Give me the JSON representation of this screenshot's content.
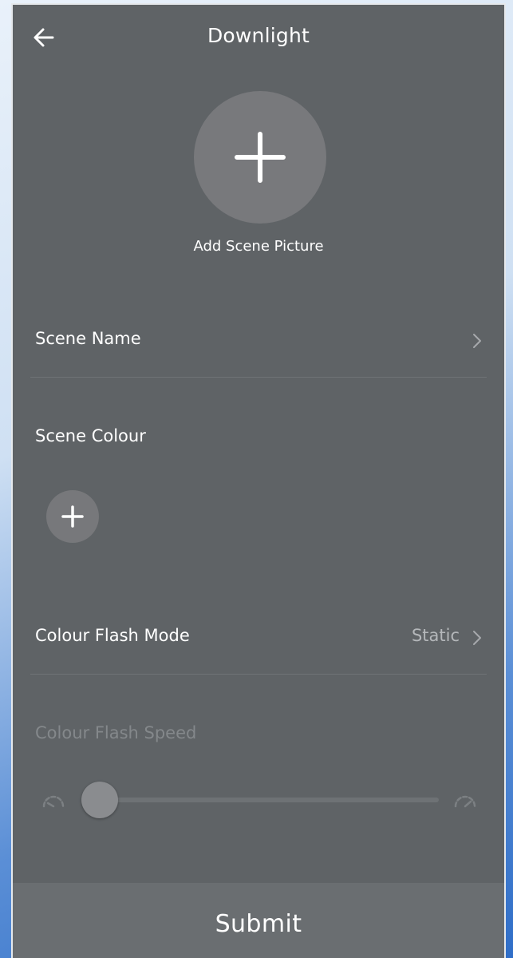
{
  "header": {
    "title": "Downlight",
    "back_icon": "arrow-left-icon"
  },
  "scene_picture": {
    "icon": "plus-icon",
    "label": "Add Scene Picture"
  },
  "scene_name": {
    "label": "Scene Name",
    "icon": "chevron-right-icon"
  },
  "scene_colour": {
    "label": "Scene Colour",
    "add_icon": "plus-icon"
  },
  "flash_mode": {
    "label": "Colour Flash Mode",
    "value": "Static",
    "icon": "chevron-right-icon"
  },
  "flash_speed": {
    "label": "Colour Flash Speed",
    "slow_icon": "speedometer-slow-icon",
    "fast_icon": "speedometer-fast-icon",
    "level": 0
  },
  "submit": {
    "label": "Submit"
  },
  "colors": {
    "panel_bg": "#5f6366",
    "submit_bg": "#6a6e71",
    "circle_bg": "#78797c",
    "text": "#ffffff",
    "muted_text": "#84888b"
  }
}
